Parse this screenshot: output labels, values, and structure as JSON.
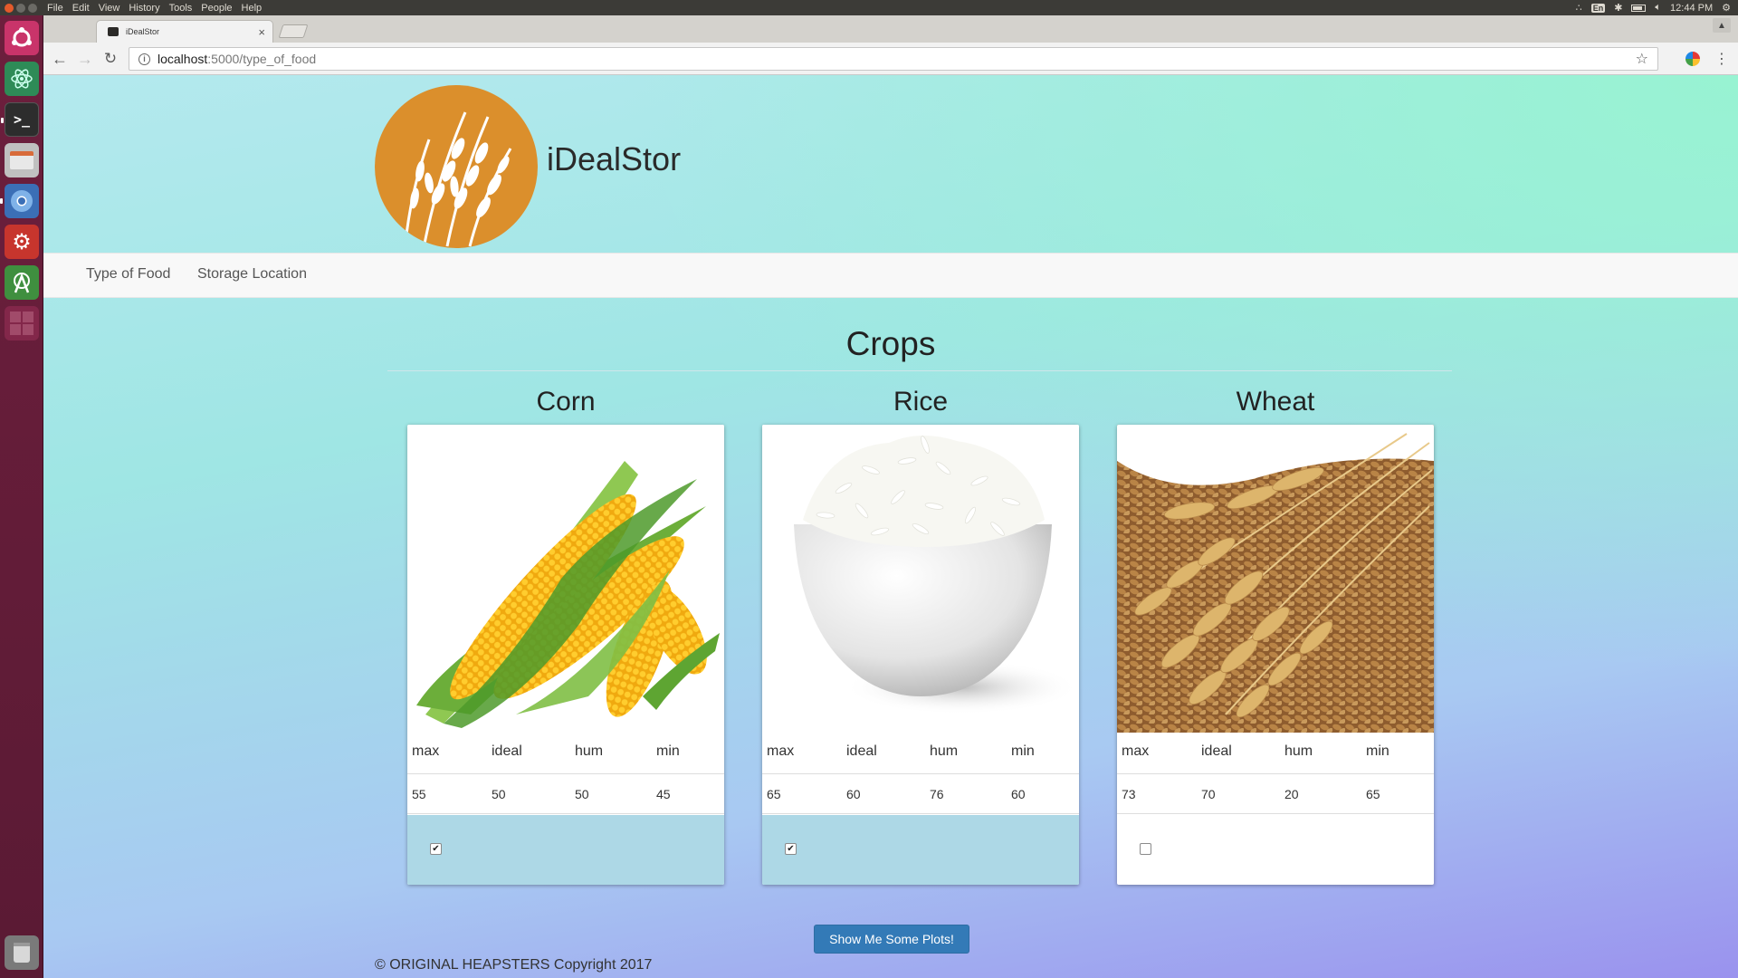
{
  "system": {
    "menu": [
      "File",
      "Edit",
      "View",
      "History",
      "Tools",
      "People",
      "Help"
    ],
    "clock": "12:44 PM",
    "keyboard_layout": "En"
  },
  "browser": {
    "tab_title": "iDealStor",
    "tab_close": "×",
    "url_host": "localhost",
    "url_path": ":5000/type_of_food"
  },
  "site": {
    "brand": "iDealStor",
    "nav": [
      "Type of Food",
      "Storage Location"
    ],
    "section_title": "Crops",
    "columns": [
      "max",
      "ideal",
      "hum",
      "min"
    ],
    "crops": [
      {
        "name": "Corn",
        "values": [
          "55",
          "50",
          "50",
          "45"
        ],
        "selected": true
      },
      {
        "name": "Rice",
        "values": [
          "65",
          "60",
          "76",
          "60"
        ],
        "selected": true
      },
      {
        "name": "Wheat",
        "values": [
          "73",
          "70",
          "20",
          "65"
        ],
        "selected": false
      }
    ],
    "button_label": "Show Me Some Plots!",
    "footer": "© ORIGINAL HEAPSTERS Copyright 2017"
  },
  "colors": {
    "button": "#337ab7",
    "checked_row": "#add8e6",
    "logo": "#db8f2c",
    "launcher": "#6d1f3d"
  }
}
